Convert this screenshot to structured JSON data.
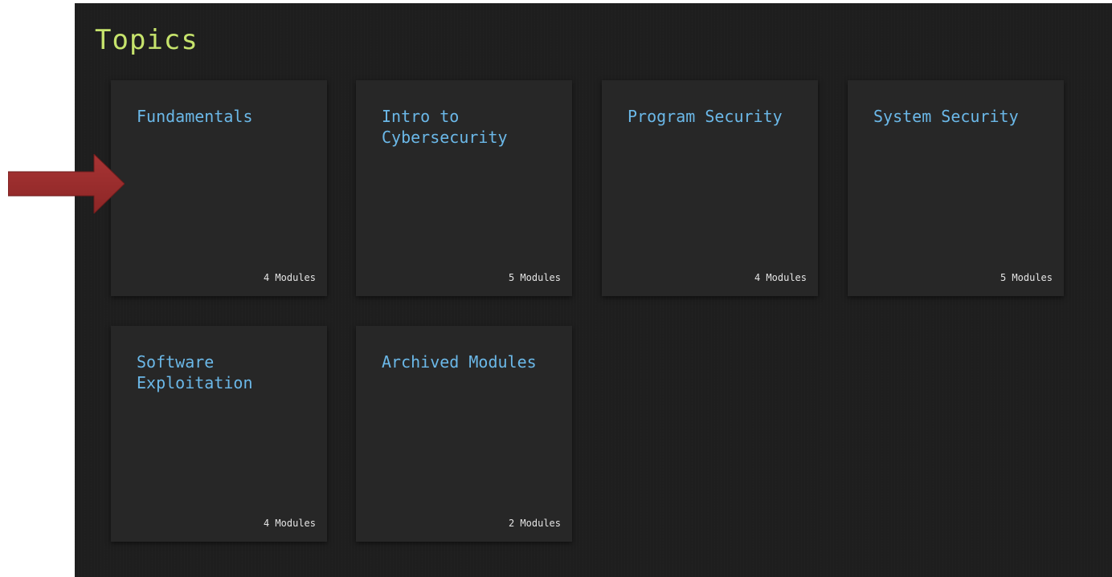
{
  "page": {
    "title": "Topics"
  },
  "topics": [
    {
      "label": "Fundamentals",
      "count": "4 Modules"
    },
    {
      "label": "Intro to Cybersecurity",
      "count": "5 Modules"
    },
    {
      "label": "Program Security",
      "count": "4 Modules"
    },
    {
      "label": "System Security",
      "count": "5 Modules"
    },
    {
      "label": "Software Exploitation",
      "count": "4 Modules"
    },
    {
      "label": "Archived Modules",
      "count": "2 Modules"
    }
  ],
  "colors": {
    "background": "#1e1e1e",
    "card": "#272727",
    "title_accent": "#c6e36c",
    "card_title": "#6bb8e8",
    "card_count": "#e4e4e4",
    "arrow": "#9b2d2d"
  },
  "icons": {
    "pointer": "right-arrow-icon"
  }
}
